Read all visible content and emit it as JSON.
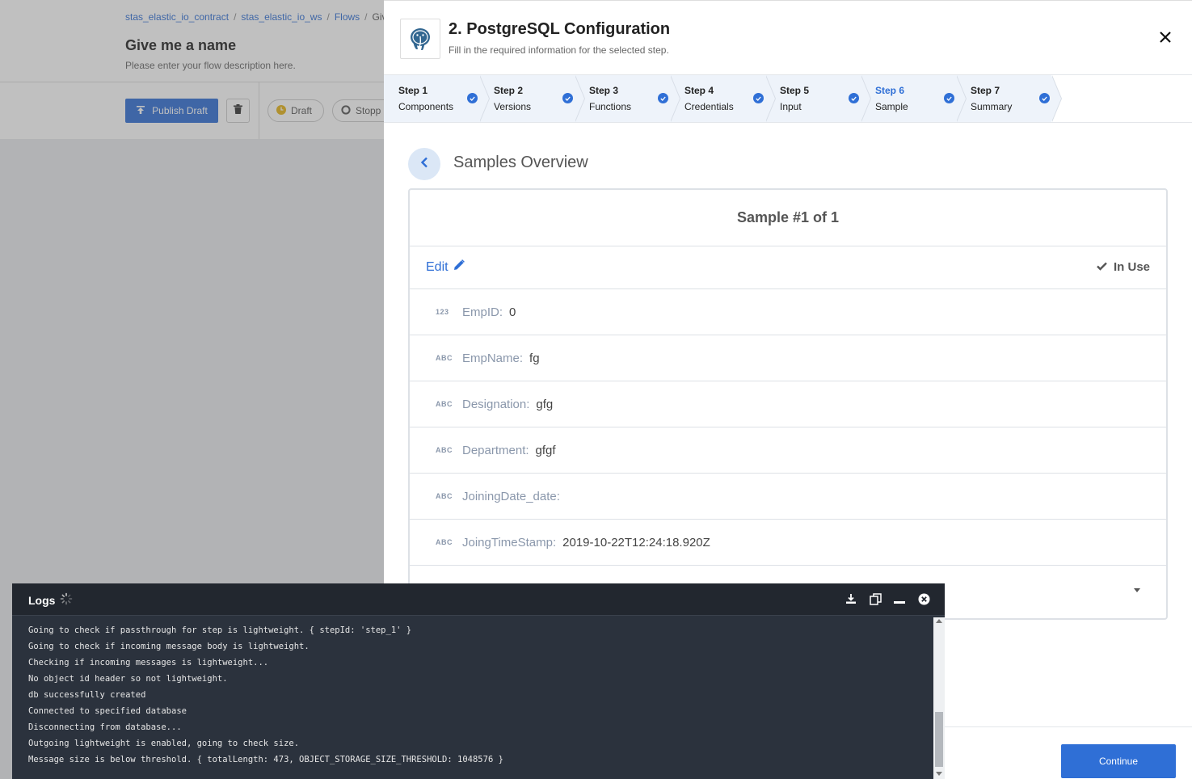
{
  "breadcrumb": {
    "items": [
      "stas_elastic_io_contract",
      "stas_elastic_io_ws",
      "Flows"
    ],
    "current": "Give"
  },
  "flow": {
    "title": "Give me a name",
    "description": "Please enter your flow description here."
  },
  "toolbar": {
    "publish_label": "Publish Draft",
    "draft_label": "Draft",
    "stop_label": "Stopp"
  },
  "modal": {
    "title": "2. PostgreSQL Configuration",
    "subtitle": "Fill in the required information for the selected step.",
    "steps": [
      {
        "num": "Step 1",
        "name": "Components"
      },
      {
        "num": "Step 2",
        "name": "Versions"
      },
      {
        "num": "Step 3",
        "name": "Functions"
      },
      {
        "num": "Step 4",
        "name": "Credentials"
      },
      {
        "num": "Step 5",
        "name": "Input"
      },
      {
        "num": "Step 6",
        "name": "Sample"
      },
      {
        "num": "Step 7",
        "name": "Summary"
      }
    ],
    "active_step": 5,
    "section_title": "Samples Overview",
    "sample_header": "Sample #1 of 1",
    "edit_label": "Edit",
    "in_use_label": "In Use",
    "fields": [
      {
        "type": "123",
        "label": "EmpID:",
        "value": "0"
      },
      {
        "type": "ABC",
        "label": "EmpName:",
        "value": "fg"
      },
      {
        "type": "ABC",
        "label": "Designation:",
        "value": "gfg"
      },
      {
        "type": "ABC",
        "label": "Department:",
        "value": "gfgf"
      },
      {
        "type": "ABC",
        "label": "JoiningDate_date:",
        "value": ""
      },
      {
        "type": "ABC",
        "label": "JoingTimeStamp:",
        "value": "2019-10-22T12:24:18.920Z"
      }
    ],
    "continue_label": "Continue"
  },
  "logs": {
    "title": "Logs",
    "lines": [
      "Going to check if passthrough for step is lightweight. { stepId: 'step_1' }",
      "Going to check if incoming message body is lightweight.",
      "Checking if incoming messages is lightweight...",
      "No object id header so not lightweight.",
      "db successfully created",
      "Connected to specified database",
      "Disconnecting from database...",
      "Outgoing lightweight is enabled, going to check size.",
      "Message size is below threshold. { totalLength: 473, OBJECT_STORAGE_SIZE_THRESHOLD: 1048576 }"
    ]
  },
  "colors": {
    "accent": "#2f6fd6",
    "logs_bg": "#2b323d",
    "step_bg": "#eef3fa"
  }
}
